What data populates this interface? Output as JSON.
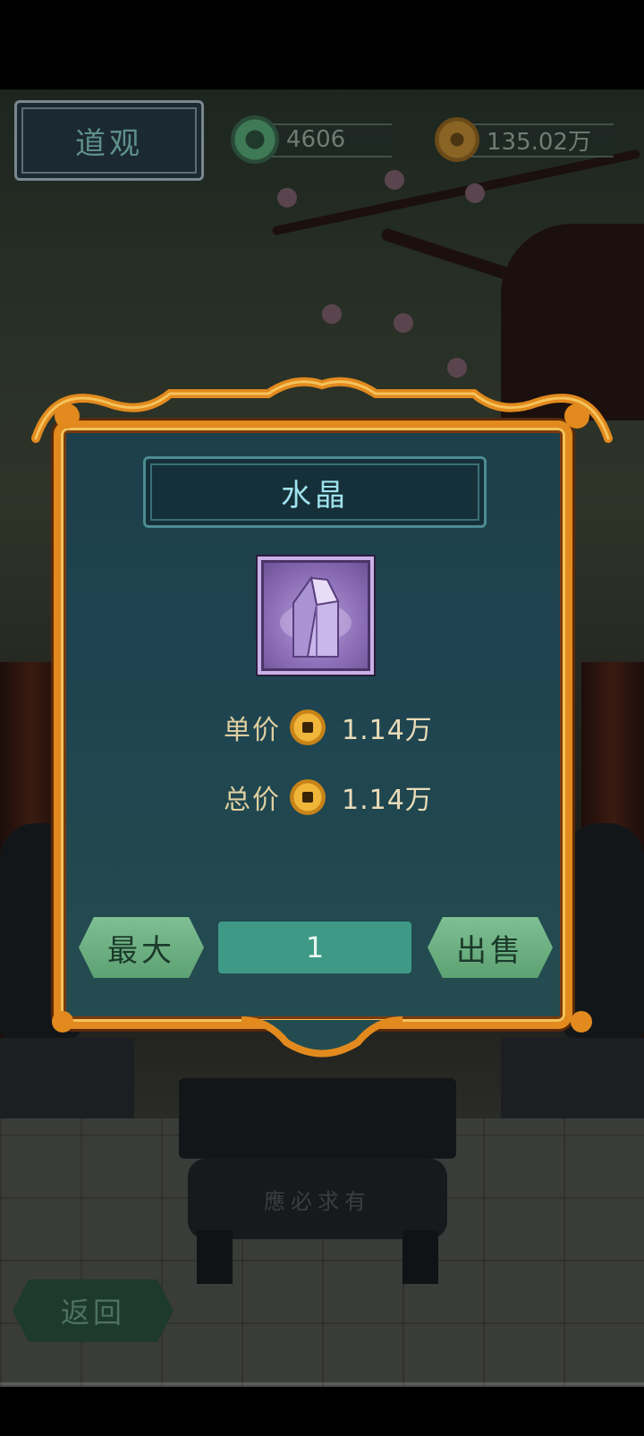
{
  "header": {
    "location_title": "道观",
    "jade_count": "4606",
    "coin_count": "135.02万"
  },
  "dialog": {
    "item_name": "水晶",
    "item_icon": "crystal-icon",
    "unit_price_label": "单价",
    "unit_price_value": "1.14万",
    "total_price_label": "总价",
    "total_price_value": "1.14万",
    "max_button_label": "最大",
    "quantity_value": "1",
    "sell_button_label": "出售"
  },
  "scene": {
    "censer_inscription": "應必求有"
  },
  "footer": {
    "back_button_label": "返回"
  },
  "colors": {
    "dialog_border": "#e28a1e",
    "dialog_bg": "#1e4350",
    "title_text": "#9ee3ee",
    "button_green": "#6fb083",
    "qty_field": "#3e9a86"
  }
}
